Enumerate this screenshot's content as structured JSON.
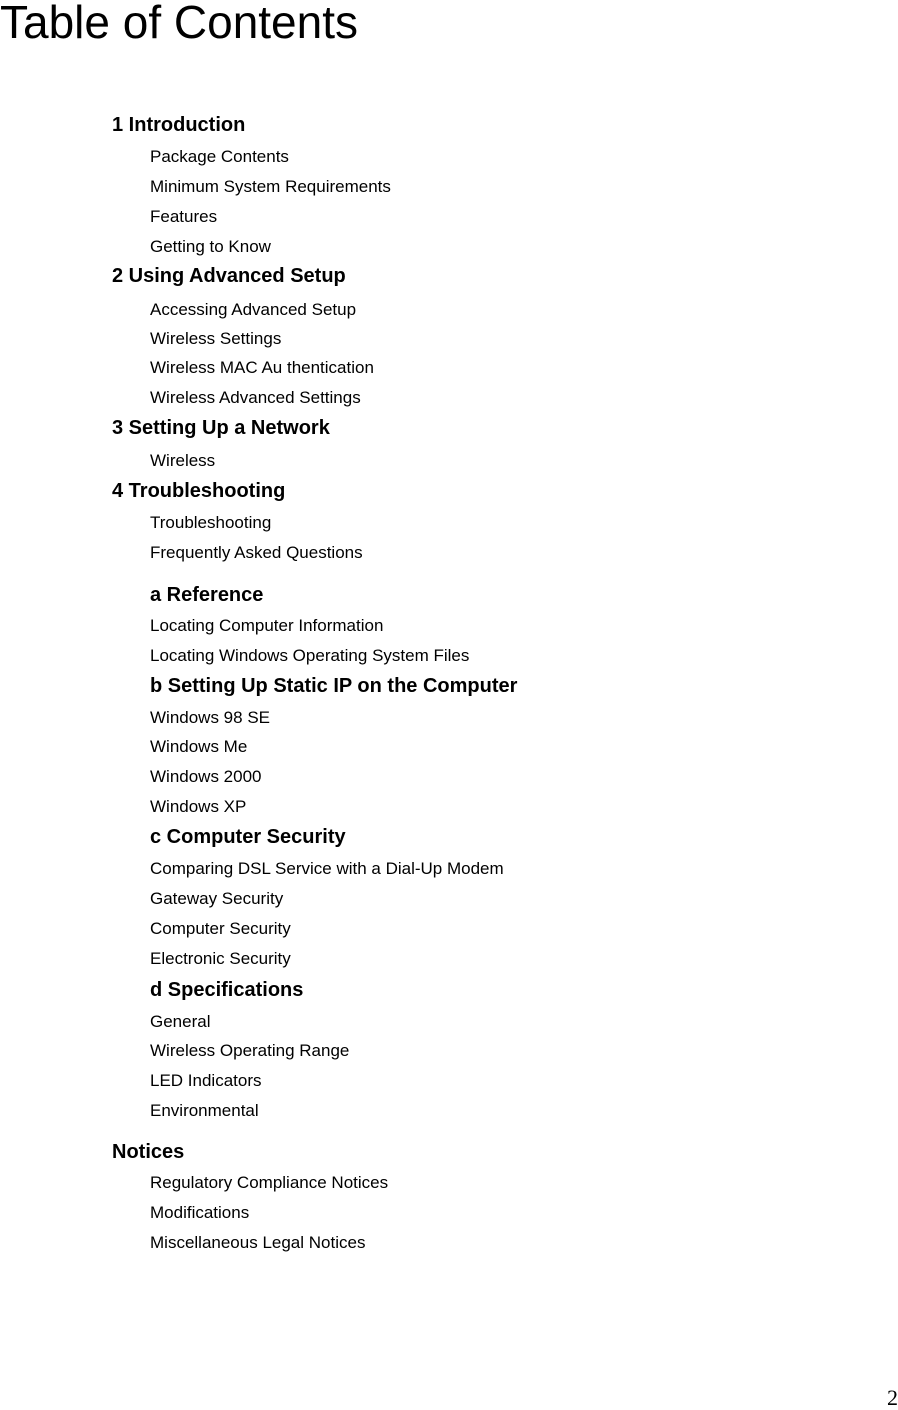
{
  "page": {
    "title": "Table of Contents",
    "page_number": "2"
  },
  "toc": {
    "ch1": {
      "heading": "1 Introduction",
      "items": [
        "Package Contents",
        "Minimum System Requirements",
        "Features",
        "Getting to Know"
      ]
    },
    "ch2": {
      "heading": "2 Using Advanced Setup",
      "items": [
        "Accessing Advanced Setup",
        "Wireless Settings",
        "Wireless MAC Au thentication",
        "Wireless Advanced Settings"
      ]
    },
    "ch3": {
      "heading": "3 Setting Up a Network",
      "items": [
        "Wireless"
      ]
    },
    "ch4": {
      "heading": "4 Troubleshooting",
      "items": [
        "Troubleshooting",
        "Frequently Asked Questions"
      ]
    },
    "appA": {
      "heading": "a Reference",
      "items": [
        "Locating Computer Information",
        "Locating Windows Operating System Files"
      ]
    },
    "appB": {
      "heading": "b Setting Up Static IP on the Computer",
      "items": [
        "Windows 98 SE",
        "Windows Me",
        "Windows 2000",
        "Windows XP"
      ]
    },
    "appC": {
      "heading": "c Computer Security",
      "items": [
        "Comparing DSL Service with a Dial-Up Modem",
        "Gateway Security",
        "Computer Security",
        "Electronic Security"
      ]
    },
    "appD": {
      "heading": "d Specifications",
      "items": [
        "General",
        "Wireless Operating Range",
        "LED Indicators",
        "Environmental"
      ]
    },
    "notices": {
      "heading": "Notices",
      "items": [
        "Regulatory Compliance Notices",
        "Modifications",
        "Miscellaneous Legal Notices"
      ]
    }
  }
}
